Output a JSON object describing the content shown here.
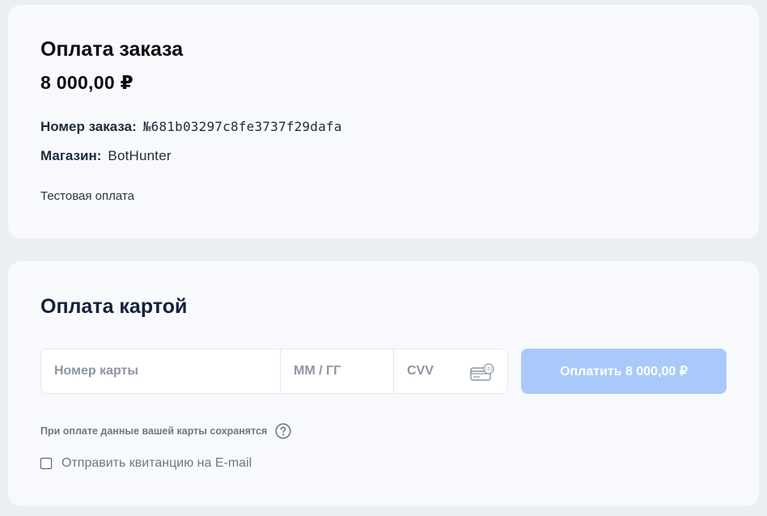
{
  "order": {
    "title": "Оплата заказа",
    "amount": "8 000,00 ₽",
    "order_number_label": "Номер заказа:",
    "order_number_value": "№681b03297c8fe3737f29dafa",
    "shop_label": "Магазин:",
    "shop_value": "BotHunter",
    "description": "Тестовая оплата"
  },
  "payment": {
    "title": "Оплата картой",
    "card_number_placeholder": "Номер карты",
    "expiry_placeholder": "ММ / ГГ",
    "cvv_placeholder": "CVV",
    "cvv_icon": "card-cvv-icon",
    "pay_button_label": "Оплатить 8 000,00 ₽",
    "save_note": "При оплате данные вашей карты сохранятся",
    "help_icon": "question-circle-icon",
    "receipt_label": "Отправить квитанцию на E-mail",
    "receipt_checked": false
  },
  "colors": {
    "pay_button_disabled": "#a9c9fb",
    "card_background": "#f7f9fc",
    "page_background": "#ebeef3"
  }
}
